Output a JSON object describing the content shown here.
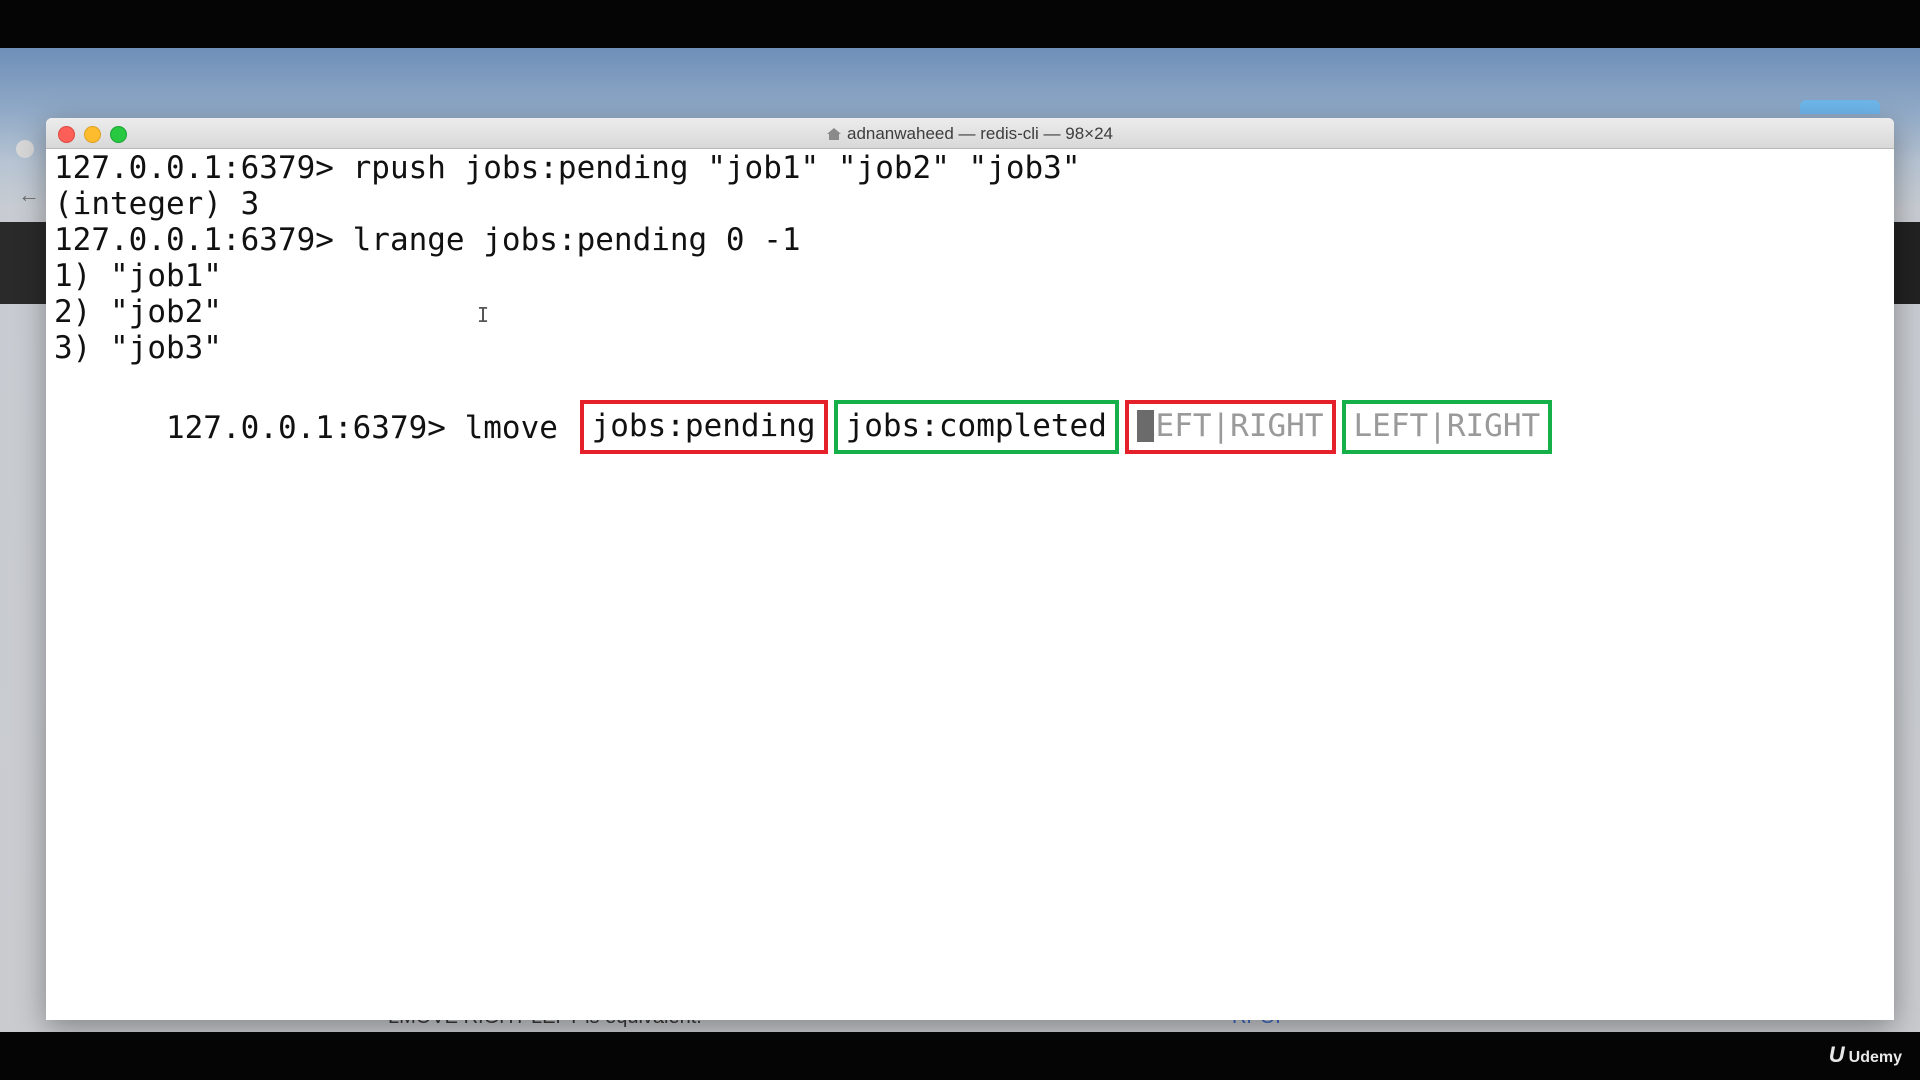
{
  "window": {
    "title": "adnanwaheed — redis-cli — 98×24"
  },
  "terminal": {
    "lines": [
      "127.0.0.1:6379> rpush jobs:pending \"job1\" \"job2\" \"job3\"",
      "(integer) 3",
      "127.0.0.1:6379> lrange jobs:pending 0 -1",
      "1) \"job1\"",
      "2) \"job2\"",
      "3) \"job3\""
    ],
    "current": {
      "prompt": "127.0.0.1:6379> lmove ",
      "arg_source": "jobs:pending",
      "arg_destination": "jobs:completed",
      "hint_wherefrom_first": "L",
      "hint_wherefrom_rest": "EFT|RIGHT",
      "hint_whereto": "LEFT|RIGHT"
    },
    "cursor_glyph": "I"
  },
  "background": {
    "bottom_text": "LMOVE RIGHT LEFT is equivalent.",
    "bottom_link": "RPOP"
  },
  "watermark": {
    "brand": "Udemy",
    "logo_letter": "U"
  },
  "colors": {
    "highlight_red": "#e4202a",
    "highlight_green": "#16b04a",
    "hint_gray": "#9a9a9a"
  }
}
